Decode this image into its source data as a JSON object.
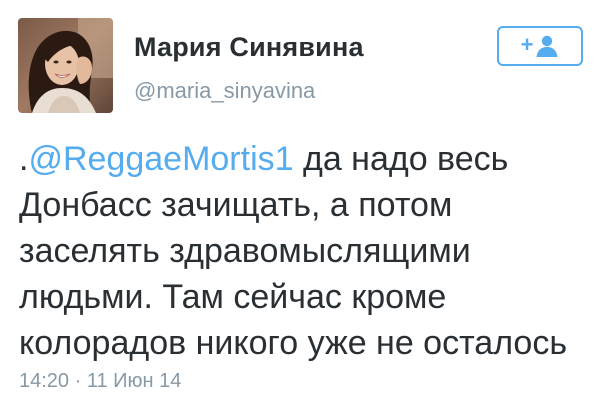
{
  "user": {
    "display_name": "Мария Синявина",
    "handle": "@maria_sinyavina",
    "avatar_icon": "profile-photo"
  },
  "follow_button": {
    "plus": "+",
    "icon": "person-icon",
    "color": "#55acee"
  },
  "tweet": {
    "prefix": ".",
    "mention": "@ReggaeMortis1",
    "line1_rest": " да надо весь",
    "line2": "Донбасс зачищать, а потом",
    "line3": "заселять здравомыслящими",
    "line4": "людьми. Там сейчас кроме",
    "line5": "колорадов никого уже не осталось"
  },
  "meta": {
    "timestamp": "14:20 · 11 Июн 14"
  },
  "colors": {
    "accent": "#55acee",
    "text": "#292f33",
    "muted": "#8899a6"
  }
}
